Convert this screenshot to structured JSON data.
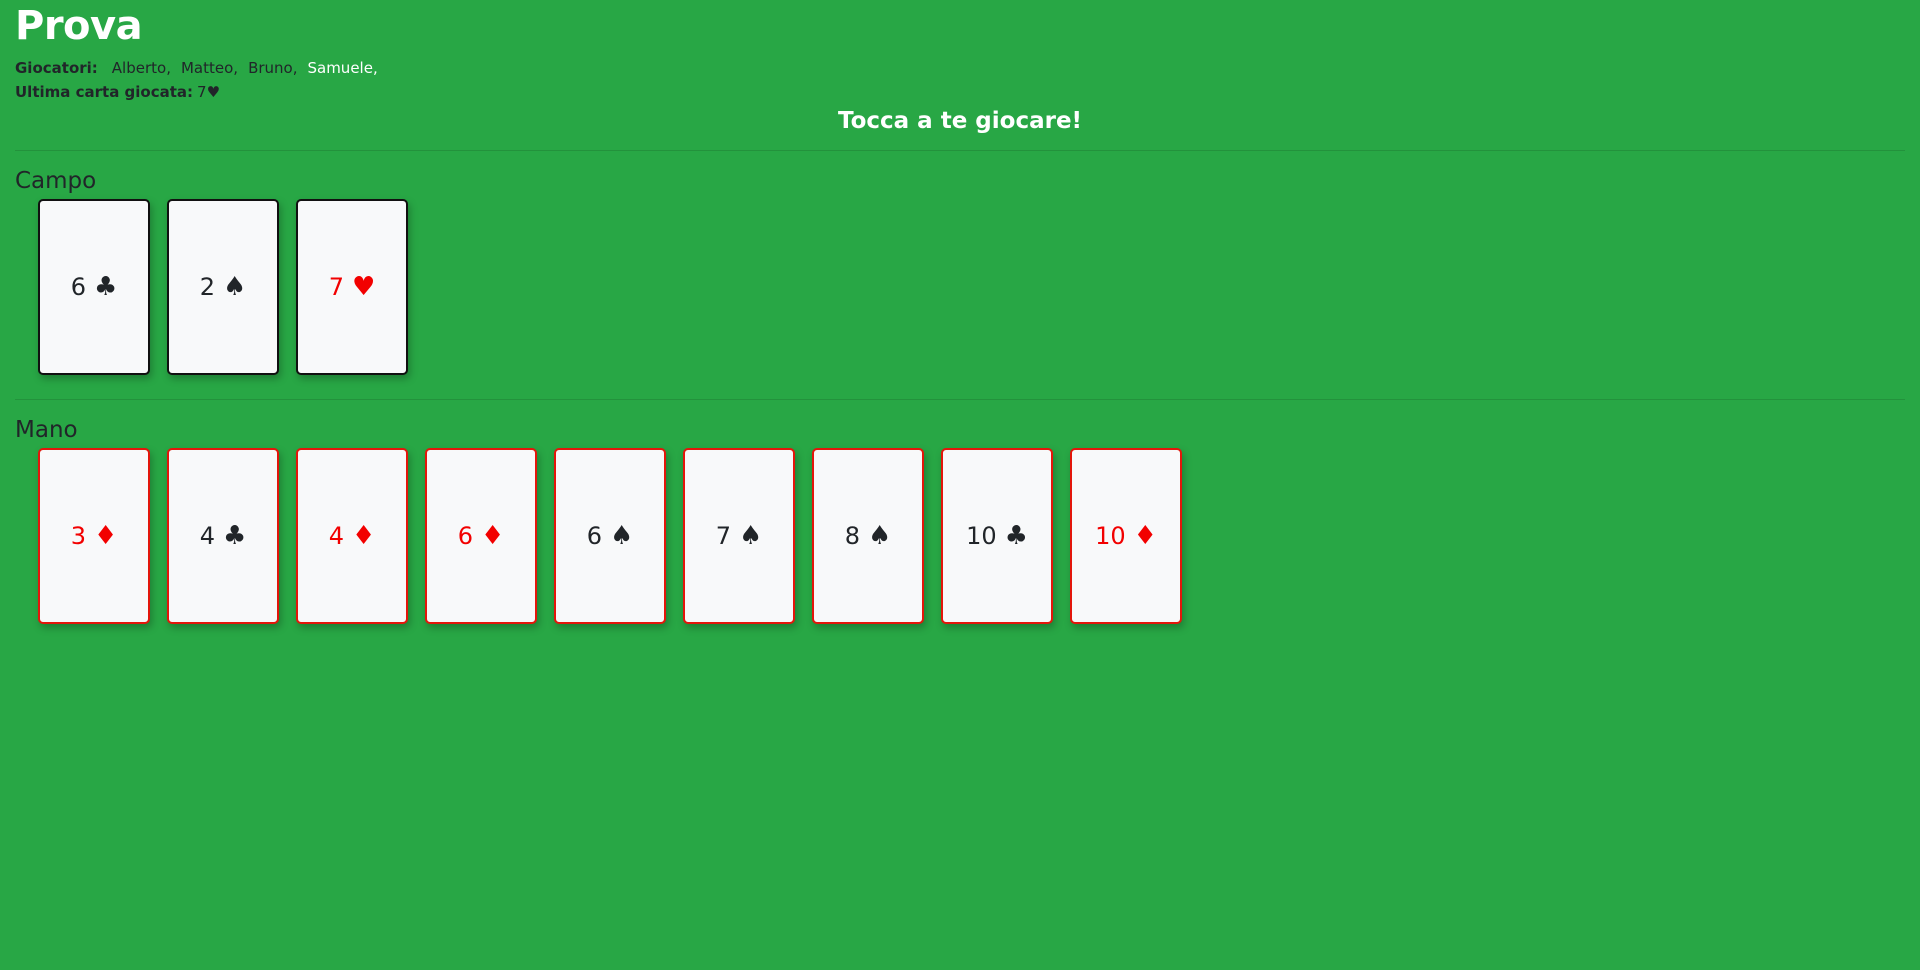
{
  "header": {
    "title": "Prova",
    "players_label": "Giocatori:",
    "players": [
      {
        "name": "Alberto,",
        "active": false
      },
      {
        "name": "Matteo,",
        "active": false
      },
      {
        "name": "Bruno,",
        "active": false
      },
      {
        "name": "Samuele,",
        "active": true
      }
    ],
    "last_card_label": "Ultima carta giocata:",
    "last_card_value": "7♥",
    "turn_message": "Tocca a te giocare!"
  },
  "campo": {
    "title": "Campo",
    "cards": [
      {
        "rank": "6",
        "suit": "♣",
        "color": "black"
      },
      {
        "rank": "2",
        "suit": "♠",
        "color": "black"
      },
      {
        "rank": "7",
        "suit": "♥",
        "color": "red"
      }
    ]
  },
  "mano": {
    "title": "Mano",
    "cards": [
      {
        "rank": "3",
        "suit": "♦",
        "color": "red"
      },
      {
        "rank": "4",
        "suit": "♣",
        "color": "black"
      },
      {
        "rank": "4",
        "suit": "♦",
        "color": "red"
      },
      {
        "rank": "6",
        "suit": "♦",
        "color": "red"
      },
      {
        "rank": "6",
        "suit": "♠",
        "color": "black"
      },
      {
        "rank": "7",
        "suit": "♠",
        "color": "black"
      },
      {
        "rank": "8",
        "suit": "♠",
        "color": "black"
      },
      {
        "rank": "10",
        "suit": "♣",
        "color": "black"
      },
      {
        "rank": "10",
        "suit": "♦",
        "color": "red"
      }
    ]
  },
  "colors": {
    "background": "#28a745",
    "red_suit": "#f20000",
    "hand_border": "#e3160b"
  }
}
